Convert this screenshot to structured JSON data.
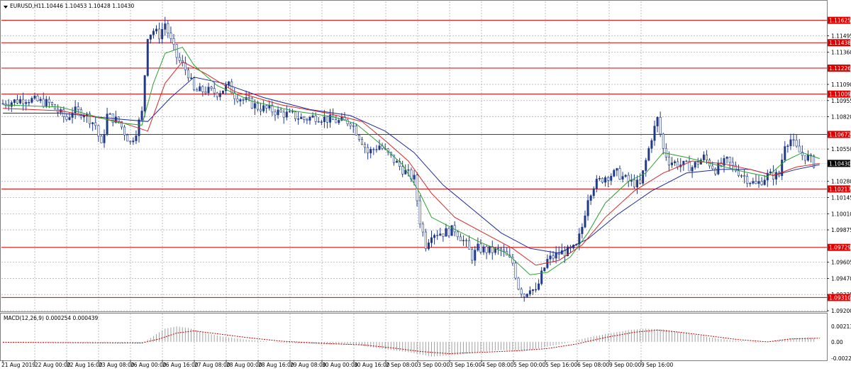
{
  "header": {
    "title": "EURUSD,H1",
    "ohlc": "1.10446 1.10453 1.10428 1.10430"
  },
  "macd_header": {
    "label": "MACD(12,26,9) 0.000254 0.000439"
  },
  "colors": {
    "background": "#ffffff",
    "grid": "#b0b0b0",
    "candle": "#1f3a8a",
    "level_line": "#d60000",
    "level_box": "#e00000",
    "ma_fast": "#2ca02c",
    "ma_mid": "#d62728",
    "ma_slow": "#1f2a9a",
    "current_price_box": "#000000",
    "macd_hist": "#a0a0a0",
    "macd_signal": "#c00000"
  },
  "icons": {
    "dropdown": "triangle-down-icon"
  },
  "chart_data": [
    {
      "type": "candlestick",
      "symbol": "EURUSD",
      "timeframe": "H1",
      "ylim": [
        1.092,
        1.117
      ],
      "yticks": [
        "1.11495",
        "1.11360",
        "1.11090",
        "1.10955",
        "1.10820",
        "1.10550",
        "1.10280",
        "1.10145",
        "1.10010",
        "1.09875",
        "1.09605",
        "1.09470",
        "1.09335",
        "1.09200"
      ],
      "price_levels": [
        "1.11625",
        "1.11438",
        "1.11226",
        "1.11009",
        "1.10672",
        "1.10217",
        "1.09729",
        "1.09310"
      ],
      "current_price": "1.10430",
      "xticks": [
        "21 Aug 2019",
        "22 Aug 00:00",
        "22 Aug 16:00",
        "23 Aug 08:00",
        "26 Aug 00:00",
        "26 Aug 16:00",
        "27 Aug 08:00",
        "28 Aug 00:00",
        "28 Aug 16:00",
        "29 Aug 08:00",
        "30 Aug 00:00",
        "30 Aug 16:00",
        "2 Sep 08:00",
        "3 Sep 00:00",
        "3 Sep 16:00",
        "4 Sep 08:00",
        "5 Sep 00:00",
        "5 Sep 16:00",
        "6 Sep 08:00",
        "9 Sep 00:00",
        "9 Sep 16:00"
      ],
      "price_path": [
        [
          0,
          1.1093
        ],
        [
          8,
          1.1097
        ],
        [
          16,
          1.1093
        ],
        [
          22,
          1.108
        ],
        [
          24,
          1.1087
        ],
        [
          28,
          1.1085
        ],
        [
          32,
          1.1075
        ],
        [
          34,
          1.1057
        ],
        [
          36,
          1.1083
        ],
        [
          40,
          1.1078
        ],
        [
          44,
          1.106
        ],
        [
          46,
          1.107
        ],
        [
          48,
          1.1085
        ],
        [
          50,
          1.115
        ],
        [
          52,
          1.1154
        ],
        [
          54,
          1.115
        ],
        [
          56,
          1.116
        ],
        [
          58,
          1.1145
        ],
        [
          60,
          1.1132
        ],
        [
          62,
          1.1125
        ],
        [
          64,
          1.1118
        ],
        [
          66,
          1.1103
        ],
        [
          70,
          1.1104
        ],
        [
          74,
          1.1102
        ],
        [
          78,
          1.1108
        ],
        [
          80,
          1.11
        ],
        [
          84,
          1.1095
        ],
        [
          88,
          1.109
        ],
        [
          92,
          1.1088
        ],
        [
          96,
          1.1085
        ],
        [
          100,
          1.1083
        ],
        [
          104,
          1.108
        ],
        [
          108,
          1.1082
        ],
        [
          112,
          1.108
        ],
        [
          116,
          1.1078
        ],
        [
          120,
          1.1078
        ],
        [
          124,
          1.1062
        ],
        [
          126,
          1.1052
        ],
        [
          130,
          1.1058
        ],
        [
          134,
          1.1048
        ],
        [
          138,
          1.1038
        ],
        [
          142,
          1.103
        ],
        [
          144,
          1.0995
        ],
        [
          146,
          1.0975
        ],
        [
          148,
          1.0985
        ],
        [
          152,
          1.0985
        ],
        [
          156,
          1.0988
        ],
        [
          160,
          1.0975
        ],
        [
          162,
          1.0965
        ],
        [
          164,
          1.0972
        ],
        [
          168,
          1.097
        ],
        [
          172,
          1.097
        ],
        [
          176,
          1.096
        ],
        [
          178,
          1.094
        ],
        [
          180,
          1.0933
        ],
        [
          182,
          1.094
        ],
        [
          184,
          1.0935
        ],
        [
          186,
          1.095
        ],
        [
          188,
          1.0962
        ],
        [
          192,
          1.0968
        ],
        [
          196,
          1.097
        ],
        [
          198,
          1.0973
        ],
        [
          200,
          1.099
        ],
        [
          202,
          1.1015
        ],
        [
          204,
          1.1025
        ],
        [
          208,
          1.1032
        ],
        [
          212,
          1.1035
        ],
        [
          216,
          1.1028
        ],
        [
          220,
          1.1025
        ],
        [
          222,
          1.1045
        ],
        [
          224,
          1.1065
        ],
        [
          226,
          1.108
        ],
        [
          228,
          1.1055
        ],
        [
          230,
          1.1045
        ],
        [
          234,
          1.1042
        ],
        [
          238,
          1.104
        ],
        [
          242,
          1.1048
        ],
        [
          246,
          1.1038
        ],
        [
          250,
          1.1045
        ],
        [
          252,
          1.104
        ],
        [
          256,
          1.1032
        ],
        [
          260,
          1.1025
        ],
        [
          264,
          1.1033
        ],
        [
          268,
          1.1033
        ],
        [
          270,
          1.106
        ],
        [
          272,
          1.1063
        ],
        [
          274,
          1.1055
        ],
        [
          276,
          1.105
        ],
        [
          278,
          1.1048
        ],
        [
          280,
          1.1043
        ]
      ],
      "ma_fast": [
        [
          0,
          1.1092
        ],
        [
          20,
          1.109
        ],
        [
          40,
          1.1077
        ],
        [
          48,
          1.1075
        ],
        [
          52,
          1.111
        ],
        [
          56,
          1.1135
        ],
        [
          62,
          1.114
        ],
        [
          66,
          1.1125
        ],
        [
          74,
          1.1108
        ],
        [
          86,
          1.1095
        ],
        [
          100,
          1.1087
        ],
        [
          114,
          1.1082
        ],
        [
          122,
          1.1076
        ],
        [
          130,
          1.106
        ],
        [
          138,
          1.1042
        ],
        [
          144,
          1.1018
        ],
        [
          148,
          1.0998
        ],
        [
          156,
          1.0988
        ],
        [
          164,
          1.0978
        ],
        [
          174,
          1.0968
        ],
        [
          182,
          1.095
        ],
        [
          188,
          1.0952
        ],
        [
          196,
          1.0965
        ],
        [
          202,
          1.0985
        ],
        [
          208,
          1.101
        ],
        [
          216,
          1.1028
        ],
        [
          222,
          1.1035
        ],
        [
          228,
          1.1052
        ],
        [
          236,
          1.1048
        ],
        [
          246,
          1.1042
        ],
        [
          256,
          1.1036
        ],
        [
          264,
          1.1032
        ],
        [
          270,
          1.1045
        ],
        [
          276,
          1.1052
        ],
        [
          282,
          1.1047
        ]
      ],
      "ma_mid": [
        [
          0,
          1.1089
        ],
        [
          20,
          1.1087
        ],
        [
          40,
          1.1078
        ],
        [
          50,
          1.107
        ],
        [
          56,
          1.111
        ],
        [
          62,
          1.1128
        ],
        [
          70,
          1.1118
        ],
        [
          80,
          1.1103
        ],
        [
          96,
          1.1092
        ],
        [
          112,
          1.1085
        ],
        [
          124,
          1.1078
        ],
        [
          132,
          1.1062
        ],
        [
          140,
          1.1045
        ],
        [
          148,
          1.1018
        ],
        [
          156,
          1.0998
        ],
        [
          166,
          1.0985
        ],
        [
          176,
          1.0972
        ],
        [
          184,
          1.0958
        ],
        [
          192,
          1.0962
        ],
        [
          200,
          1.0975
        ],
        [
          208,
          1.0998
        ],
        [
          218,
          1.102
        ],
        [
          228,
          1.1035
        ],
        [
          238,
          1.1045
        ],
        [
          248,
          1.1043
        ],
        [
          258,
          1.1038
        ],
        [
          266,
          1.1033
        ],
        [
          274,
          1.104
        ],
        [
          282,
          1.1043
        ]
      ],
      "ma_slow": [
        [
          0,
          1.1085
        ],
        [
          20,
          1.1085
        ],
        [
          40,
          1.108
        ],
        [
          50,
          1.1078
        ],
        [
          58,
          1.1098
        ],
        [
          66,
          1.1115
        ],
        [
          76,
          1.111
        ],
        [
          90,
          1.1098
        ],
        [
          106,
          1.1088
        ],
        [
          120,
          1.1083
        ],
        [
          132,
          1.107
        ],
        [
          142,
          1.1052
        ],
        [
          152,
          1.1025
        ],
        [
          162,
          1.1005
        ],
        [
          172,
          1.0985
        ],
        [
          182,
          1.0972
        ],
        [
          192,
          1.0968
        ],
        [
          202,
          1.098
        ],
        [
          212,
          1.1
        ],
        [
          224,
          1.102
        ],
        [
          236,
          1.1035
        ],
        [
          248,
          1.1038
        ],
        [
          258,
          1.1038
        ],
        [
          266,
          1.1033
        ],
        [
          274,
          1.1038
        ],
        [
          282,
          1.1042
        ]
      ]
    },
    {
      "type": "macd",
      "ylim": [
        -0.00232,
        0.0025
      ],
      "yticks": [
        "0.002134",
        "0.00",
        "-0.002205"
      ],
      "histogram": [
        [
          0,
          -5e-05
        ],
        [
          20,
          -0.0001
        ],
        [
          40,
          -0.00015
        ],
        [
          48,
          -0.0002
        ],
        [
          52,
          0.0008
        ],
        [
          56,
          0.0018
        ],
        [
          60,
          0.0021
        ],
        [
          64,
          0.0019
        ],
        [
          70,
          0.0012
        ],
        [
          76,
          0.0007
        ],
        [
          84,
          0.0003
        ],
        [
          96,
          -0.0001
        ],
        [
          110,
          -0.0003
        ],
        [
          122,
          -0.0004
        ],
        [
          130,
          -0.0009
        ],
        [
          140,
          -0.0014
        ],
        [
          148,
          -0.002
        ],
        [
          156,
          -0.0018
        ],
        [
          164,
          -0.0014
        ],
        [
          172,
          -0.0011
        ],
        [
          180,
          -0.0012
        ],
        [
          186,
          -0.0008
        ],
        [
          194,
          -0.0002
        ],
        [
          202,
          0.0006
        ],
        [
          210,
          0.0012
        ],
        [
          216,
          0.0016
        ],
        [
          222,
          0.0018
        ],
        [
          228,
          0.0017
        ],
        [
          236,
          0.0012
        ],
        [
          244,
          0.0006
        ],
        [
          252,
          0.0002
        ],
        [
          260,
          -0.0001
        ],
        [
          266,
          0.0001
        ],
        [
          272,
          0.0005
        ],
        [
          278,
          0.0006
        ],
        [
          282,
          0.0004
        ]
      ],
      "signal": [
        [
          0,
          -5e-05
        ],
        [
          20,
          -0.0001
        ],
        [
          48,
          -0.00015
        ],
        [
          54,
          0.0004
        ],
        [
          60,
          0.0012
        ],
        [
          66,
          0.0015
        ],
        [
          74,
          0.0011
        ],
        [
          84,
          0.0006
        ],
        [
          96,
          0.0001
        ],
        [
          110,
          -0.0002
        ],
        [
          124,
          -0.0004
        ],
        [
          134,
          -0.0008
        ],
        [
          144,
          -0.0013
        ],
        [
          154,
          -0.0016
        ],
        [
          166,
          -0.0014
        ],
        [
          178,
          -0.0012
        ],
        [
          188,
          -0.0009
        ],
        [
          198,
          -0.0003
        ],
        [
          208,
          0.0006
        ],
        [
          218,
          0.0013
        ],
        [
          226,
          0.0016
        ],
        [
          234,
          0.0013
        ],
        [
          244,
          0.0008
        ],
        [
          254,
          0.0003
        ],
        [
          264,
          0.0
        ],
        [
          272,
          0.0004
        ],
        [
          282,
          0.0005
        ]
      ]
    }
  ]
}
